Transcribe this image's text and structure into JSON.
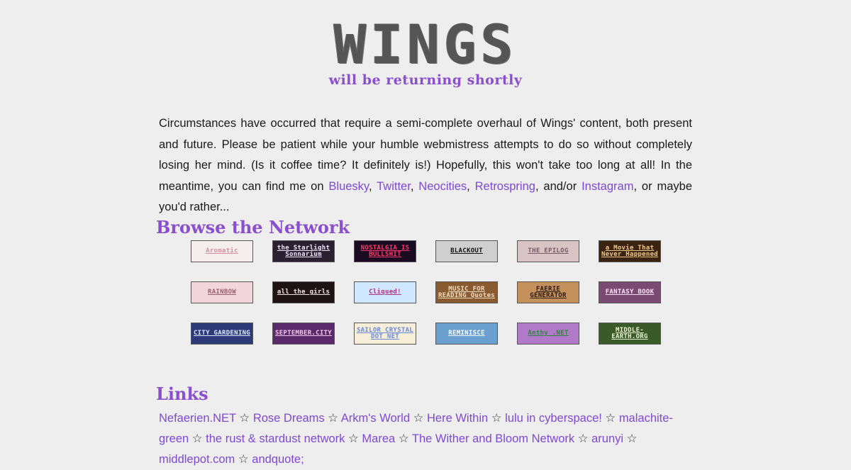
{
  "header": {
    "logo": "WINGS",
    "tagline": "will be returning shortly"
  },
  "intro": {
    "text_before": "Circumstances have occurred that require a semi-complete overhaul of Wings' content, both present and future. Please be patient while your humble webmistress attempts to do so without completely losing her mind. (Is it coffee time? It definitely is!) Hopefully, this won't take too long at all! In the meantime, you can find me on ",
    "social": [
      "Bluesky",
      "Twitter",
      "Neocities",
      "Retrospring",
      "Instagram"
    ],
    "sep_comma": ", ",
    "sep_andor": ", and/or ",
    "text_after": ", or maybe you'd rather..."
  },
  "browse": {
    "title": "Browse the Network",
    "buttons": [
      {
        "label": "Aromatic",
        "bg": "#f6eeee",
        "fg": "#d98ca0"
      },
      {
        "label": "the Starlight Sonnarium",
        "bg": "#2a2030",
        "fg": "#f0e6ff"
      },
      {
        "label": "NOSTALGIA IS BULLSHIT",
        "bg": "#1a0a22",
        "fg": "#ff3a6a"
      },
      {
        "label": "BLACKOUT",
        "bg": "#cfcfcf",
        "fg": "#111111"
      },
      {
        "label": "THE EPILOG",
        "bg": "#d8c4c4",
        "fg": "#7a5a6a"
      },
      {
        "label": "a Movie That Never Happened",
        "bg": "#3a2410",
        "fg": "#f2c888"
      },
      {
        "label": "RAINBOW",
        "bg": "#f3d6dc",
        "fg": "#9a6070"
      },
      {
        "label": "all the girls",
        "bg": "#1e1214",
        "fg": "#f4e2e6"
      },
      {
        "label": "Cliqued!",
        "bg": "#cfe8ff",
        "fg": "#b0308a"
      },
      {
        "label": "MUSIC FOR READING Quotes",
        "bg": "#8a5a30",
        "fg": "#f0dcc0"
      },
      {
        "label": "FAERIE GENERATOR",
        "bg": "#c4905c",
        "fg": "#2a1a10"
      },
      {
        "label": "FANTASY BOOK",
        "bg": "#7a4a72",
        "fg": "#ffe0f6"
      },
      {
        "label": "CITY GARDENING",
        "bg": "#2c3a7a",
        "fg": "#d8e8ff"
      },
      {
        "label": "SEPTEMBER.CITY",
        "bg": "#5a2a6a",
        "fg": "#f5c4ee"
      },
      {
        "label": "SAILOR CRYSTAL DOT NET",
        "bg": "#f6eed8",
        "fg": "#6a8ad8"
      },
      {
        "label": "REMINISCE",
        "bg": "#6aa0d0",
        "fg": "#ffffff"
      },
      {
        "label": "Anthy .NET",
        "bg": "#b07ac8",
        "fg": "#2a8a3a"
      },
      {
        "label": "MIDDLE-EARTH.ORG",
        "bg": "#3a5a28",
        "fg": "#e8f2d0"
      }
    ]
  },
  "links": {
    "title": "Links",
    "separator": " ☆ ",
    "items": [
      "Nefaerien.NET",
      "Rose Dreams",
      "Arkm's World",
      "Here Within",
      "lulu in cyberspace!",
      "malachite-green",
      "the rust & stardust network",
      "Marea",
      "The Wither and Bloom Network",
      "arunyi",
      "middlepot.com",
      "andquote;"
    ]
  },
  "colors": {
    "background": "#eeeeee",
    "accent": "#8a4fcf",
    "link": "#7d49d6",
    "logo": "#555555"
  }
}
